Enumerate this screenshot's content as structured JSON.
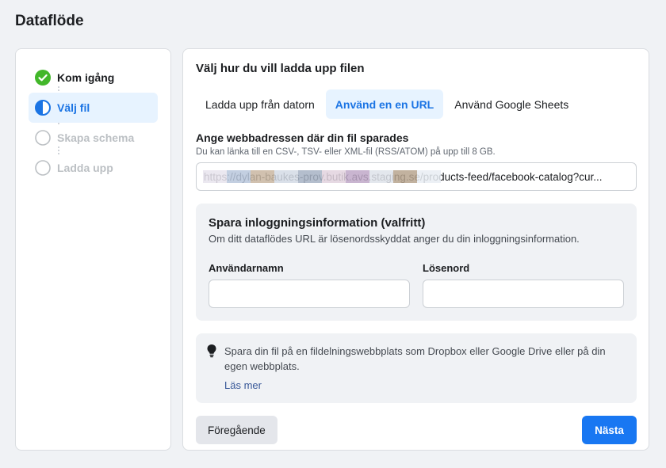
{
  "page": {
    "title": "Dataflöde"
  },
  "stepper": {
    "steps": [
      {
        "label": "Kom igång",
        "state": "done"
      },
      {
        "label": "Välj fil",
        "state": "active"
      },
      {
        "label": "Skapa schema",
        "state": "pending"
      },
      {
        "label": "Ladda upp",
        "state": "pending"
      }
    ]
  },
  "main": {
    "title": "Välj hur du vill ladda upp filen",
    "tabs": [
      {
        "label": "Ladda upp från datorn",
        "active": false
      },
      {
        "label": "Använd en en URL",
        "active": true
      },
      {
        "label": "Använd Google Sheets",
        "active": false
      }
    ],
    "url_field": {
      "label": "Ange webbadressen där din fil sparades",
      "help": "Du kan länka till en CSV-, TSV- eller XML-fil (RSS/ATOM) på upp till 8 GB.",
      "value": "https://dylan-baukes-prov.butik.avs.staging.se/products-feed/facebook-catalog?cur..."
    },
    "credentials": {
      "title": "Spara inloggningsinformation (valfritt)",
      "description": "Om ditt dataflödes URL är lösenordsskyddat anger du din inloggningsinformation.",
      "username_label": "Användarnamn",
      "username_value": "",
      "password_label": "Lösenord",
      "password_value": ""
    },
    "tip": {
      "icon": "lightbulb-icon",
      "text": "Spara din fil på en fildelningswebbplats som Dropbox eller Google Drive eller på din egen webbplats.",
      "link": "Läs mer"
    },
    "buttons": {
      "previous": "Föregående",
      "next": "Nästa"
    }
  },
  "colors": {
    "accent": "#1877f2",
    "active_tab_bg": "#e7f3ff",
    "success": "#42b72a",
    "page_bg": "#f0f2f5"
  }
}
